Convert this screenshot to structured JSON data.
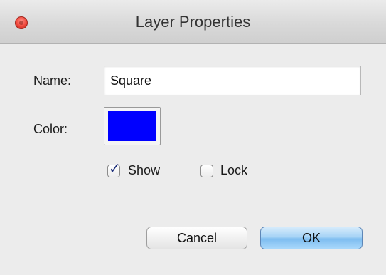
{
  "window": {
    "title": "Layer Properties"
  },
  "form": {
    "name_label": "Name:",
    "name_value": "Square",
    "color_label": "Color:",
    "color_value": "#0000ff",
    "show_label": "Show",
    "show_checked": true,
    "lock_label": "Lock",
    "lock_checked": false
  },
  "buttons": {
    "cancel_label": "Cancel",
    "ok_label": "OK"
  }
}
